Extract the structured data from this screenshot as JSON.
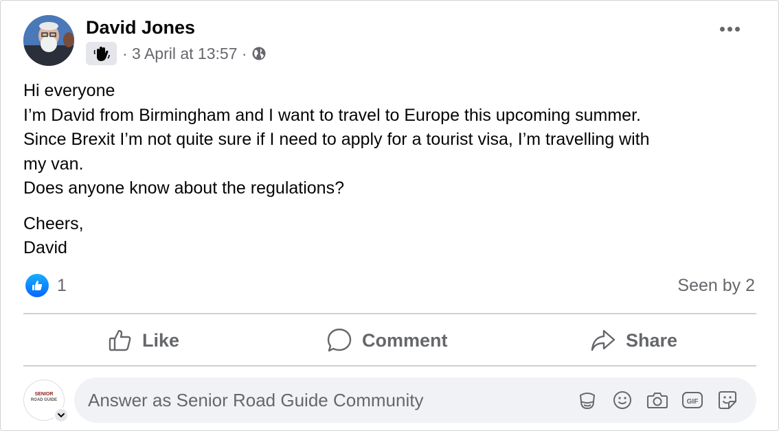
{
  "post": {
    "author": "David Jones",
    "timestamp": "· 3 April at 13:57 ·",
    "badge_icon": "waving-hand-icon",
    "audience_icon": "globe-icon",
    "body_lines": [
      "Hi everyone",
      "I’m David from Birmingham and I want to travel to Europe this upcoming summer.",
      "Since Brexit I’m not quite sure if I need to apply for a tourist visa, I’m travelling with",
      "my van.",
      "Does anyone know about the regulations?"
    ],
    "signoff_lines": [
      "Cheers,",
      "David"
    ]
  },
  "reactions": {
    "like_count": "1",
    "seen_by": "Seen by 2"
  },
  "actions": {
    "like": "Like",
    "comment": "Comment",
    "share": "Share"
  },
  "comment_box": {
    "placeholder": "Answer as Senior Road Guide Community",
    "avatar_logo_top": "SENIOR",
    "avatar_logo_bottom": "ROAD GUIDE",
    "tools": [
      "avatar-sticker-icon",
      "emoji-icon",
      "camera-icon",
      "gif-icon",
      "sticker-icon"
    ]
  },
  "colors": {
    "accent_blue": "#0866ff",
    "secondary_text": "#65676b",
    "input_bg": "#f0f2f5"
  }
}
